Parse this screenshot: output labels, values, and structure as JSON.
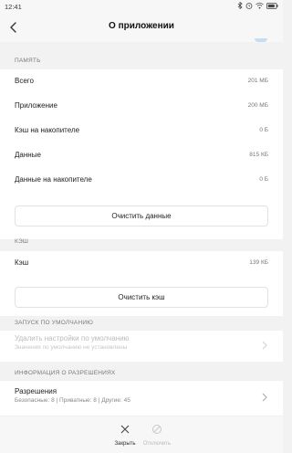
{
  "status_bar": {
    "time": "12:41",
    "icons": [
      "bluetooth-icon",
      "alarm-icon",
      "wifi-icon",
      "battery-icon"
    ]
  },
  "header": {
    "title": "О приложении",
    "back_icon": "back-arrow-icon"
  },
  "memory": {
    "section_title": "ПАМЯТЬ",
    "rows": [
      {
        "label": "Всего",
        "value": "201 МБ"
      },
      {
        "label": "Приложение",
        "value": "200 МБ"
      },
      {
        "label": "Кэш на накопителе",
        "value": "0 Б"
      },
      {
        "label": "Данные",
        "value": "815 КБ"
      },
      {
        "label": "Данные на накопителе",
        "value": "0 Б"
      }
    ],
    "clear_button": "Очистить данные"
  },
  "cache": {
    "section_title": "КЭШ",
    "row": {
      "label": "Кэш",
      "value": "139 КБ"
    },
    "clear_button": "Очистить кэш"
  },
  "default_launch": {
    "section_title": "ЗАПУСК ПО УМОЛЧАНИЮ",
    "title": "Удалить настройки по умолчанию",
    "subtitle": "Значения по умолчанию не установлены"
  },
  "permissions": {
    "section_title": "ИНФОРМАЦИЯ О РАЗРЕШЕНИЯХ",
    "title": "Разрешения",
    "subtitle": "Безопасные: 8 | Приватные: 8 | Другие: 45"
  },
  "bottom_bar": {
    "close_label": "Закрыть",
    "disable_label": "Отключить"
  },
  "colors": {
    "background": "#f2f2f2",
    "card": "#ffffff",
    "accent_blue": "#c7ddf2",
    "disabled_text": "#bbbbbb"
  }
}
